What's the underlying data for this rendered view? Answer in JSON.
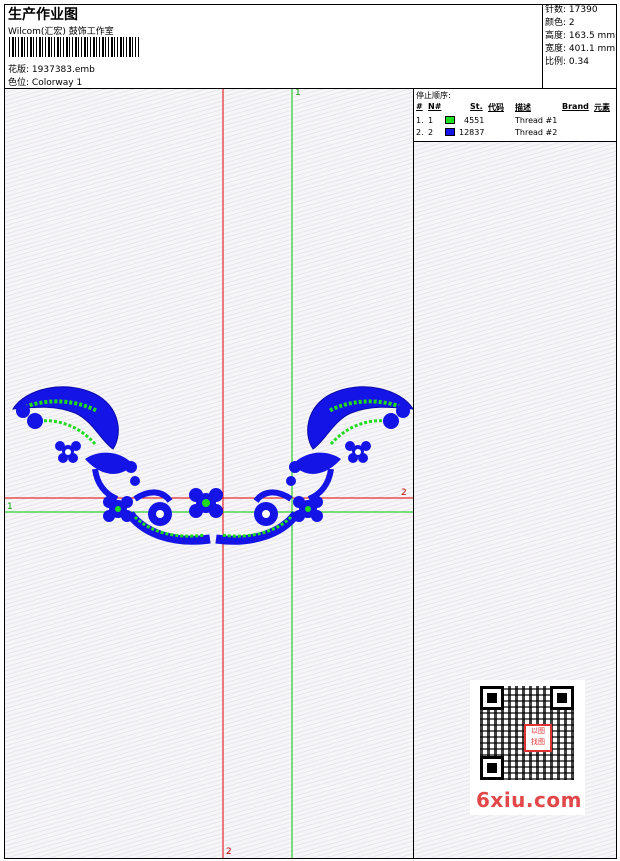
{
  "header": {
    "title": "生产作业图",
    "company": "Wilcom(汇宏) 鼓饰工作室",
    "design_label": "花版:",
    "design_value": "1937383.emb",
    "colorway_label": "色位:",
    "colorway_value": "Colorway 1"
  },
  "stats": {
    "stitches_label": "针数:",
    "stitches_value": "17390",
    "colors_label": "颜色:",
    "colors_value": "2",
    "height_label": "高度:",
    "height_value": "163.5 mm",
    "width_label": "宽度:",
    "width_value": "401.1 mm",
    "scale_label": "比例:",
    "scale_value": "0.34"
  },
  "stop_sequence": {
    "heading": "停止顺序:",
    "columns": [
      "#",
      "N#",
      "St.",
      "代码",
      "描述",
      "Brand",
      "元素"
    ],
    "rows": [
      {
        "index": "1.",
        "n": "1",
        "color": "#1fdc1f",
        "stitches": "4551",
        "description": "Thread #1"
      },
      {
        "index": "2.",
        "n": "2",
        "color": "#1414e6",
        "stitches": "12837",
        "description": "Thread #2"
      }
    ]
  },
  "guides": {
    "red_vertical_label": "2",
    "red_horizontal_label": "2",
    "green_vertical_label": "1",
    "green_horizontal_label": "1",
    "red": "#e00000",
    "green": "#00c800"
  },
  "embroidery_colors": {
    "blue": "#1414e6",
    "green": "#1fdc1f"
  },
  "qr_stamp": "以图\n找图",
  "watermark": "6xiu.com"
}
